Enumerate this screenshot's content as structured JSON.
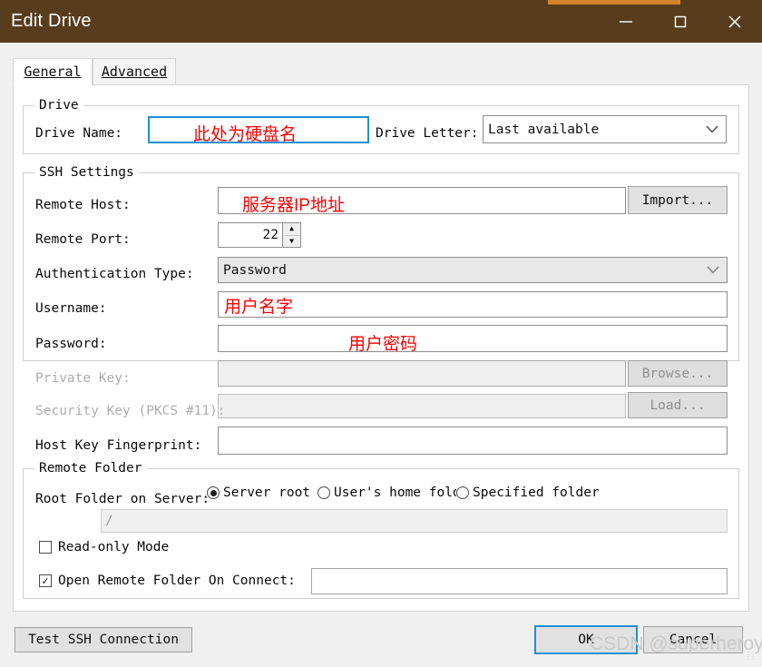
{
  "window": {
    "title": "Edit Drive",
    "minimize_label": "minimize",
    "maximize_label": "maximize",
    "close_label": "close",
    "accent_color": "#d3842a",
    "titlebar_color": "#583c1e"
  },
  "tabs": [
    {
      "label": "General",
      "active": true
    },
    {
      "label": "Advanced",
      "active": false
    }
  ],
  "drive_group": {
    "legend": "Drive",
    "drive_name_label": "Drive Name:",
    "drive_name_value": "",
    "drive_name_annotation": "此处为硬盘名",
    "drive_letter_label": "Drive Letter:",
    "drive_letter_value": "Last available"
  },
  "ssh_group": {
    "legend": "SSH Settings",
    "remote_host_label": "Remote Host:",
    "remote_host_value": "",
    "remote_host_annotation": "服务器IP地址",
    "import_button": "Import...",
    "remote_port_label": "Remote Port:",
    "remote_port_value": "22",
    "auth_type_label": "Authentication Type:",
    "auth_type_value": "Password",
    "username_label": "Username:",
    "username_value": "",
    "username_annotation": "用户名字",
    "password_label": "Password:",
    "password_value": "",
    "password_annotation": "用户密码",
    "private_key_label": "Private Key:",
    "private_key_value": "",
    "browse_button": "Browse...",
    "security_key_label": "Security Key (PKCS #11):",
    "security_key_value": "",
    "load_button": "Load...",
    "host_key_label": "Host Key Fingerprint:",
    "host_key_value": ""
  },
  "folder_group": {
    "legend": "Remote Folder",
    "root_folder_label": "Root Folder on Server:",
    "radio_server_root": "Server root",
    "radio_user_home": "User's home folder",
    "radio_specified": "Specified folder",
    "selected_radio": "server_root",
    "path_value": "/",
    "readonly_label": "Read-only Mode",
    "readonly_checked": false,
    "open_on_connect_label": "Open Remote Folder On Connect:",
    "open_on_connect_checked": true,
    "open_on_connect_value": ""
  },
  "footer": {
    "test_button": "Test SSH Connection",
    "ok_button": "OK",
    "cancel_button": "Cancel"
  },
  "watermark": {
    "text": "CSDN @superheroy"
  }
}
